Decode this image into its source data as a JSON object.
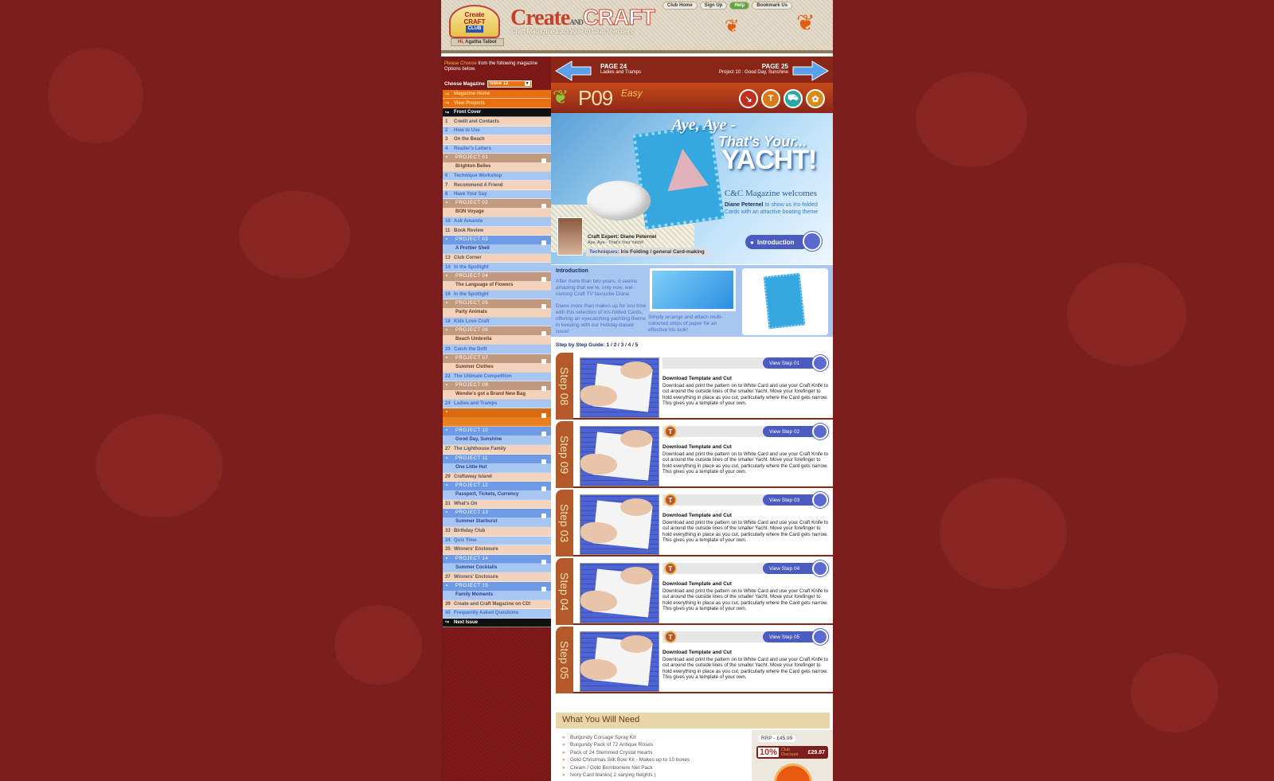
{
  "header": {
    "logo": {
      "line1": "Create",
      "line2": "CRAFT",
      "line3": "CLUB"
    },
    "greeting_hi": "Hi,",
    "greeting_name": "Agatha Talbot",
    "brand_create": "Create",
    "brand_and": "AND",
    "brand_craft": "CRAFT",
    "tagline": "Craft Magazine Exclusive to Club Members",
    "nav": [
      "Club Home",
      "Sign Up",
      "Help",
      "Bookmark Us"
    ]
  },
  "sidebar": {
    "intro_highlight": "Please Choose",
    "intro_rest": "from the following magazine Options below.",
    "choose_label": "Choose Magazine",
    "choose_value": "Issue 12",
    "top_items": [
      {
        "label": "Magazine Home"
      },
      {
        "label": "View Projects"
      },
      {
        "label": "Front Cover"
      }
    ],
    "items": [
      {
        "kind": "item",
        "num": "1",
        "label": "Credit and Contacts",
        "color": "peach"
      },
      {
        "kind": "item",
        "num": "2",
        "label": "How to Use",
        "color": "blue"
      },
      {
        "kind": "item",
        "num": "3",
        "label": "On the Beach",
        "color": "peach"
      },
      {
        "kind": "item",
        "num": "4",
        "label": "Reader's Letters",
        "color": "blue"
      },
      {
        "kind": "project",
        "proj": "PROJECT  01",
        "label": "Brighton Belles",
        "color": "brown"
      },
      {
        "kind": "item",
        "num": "6",
        "label": "Technique Workshop",
        "color": "blue"
      },
      {
        "kind": "item",
        "num": "7",
        "label": "Recommend A Friend",
        "color": "peach"
      },
      {
        "kind": "item",
        "num": "8",
        "label": "Have Your Say",
        "color": "blue"
      },
      {
        "kind": "project",
        "proj": "PROJECT  02",
        "label": "BON Voyage",
        "color": "brown"
      },
      {
        "kind": "item",
        "num": "10",
        "label": "Ask Amanda",
        "color": "blue"
      },
      {
        "kind": "item",
        "num": "11",
        "label": "Book Review",
        "color": "peach"
      },
      {
        "kind": "project",
        "proj": "PROJECT  03",
        "label": "A Prettier Shell",
        "color": "blue"
      },
      {
        "kind": "item",
        "num": "13",
        "label": "Club Corner",
        "color": "peach"
      },
      {
        "kind": "item",
        "num": "14",
        "label": "In the Spotlight",
        "color": "blue"
      },
      {
        "kind": "project",
        "proj": "PROJECT  04",
        "label": "The Language of Flowers",
        "color": "brown"
      },
      {
        "kind": "item",
        "num": "16",
        "label": "In the Spotlight",
        "color": "blue"
      },
      {
        "kind": "project",
        "proj": "PROJECT  05",
        "label": "Party Animals",
        "color": "brown"
      },
      {
        "kind": "item",
        "num": "18",
        "label": "Kids Love Craft",
        "color": "blue"
      },
      {
        "kind": "project",
        "proj": "PROJECT  06",
        "label": "Beach Umbrella",
        "color": "brown"
      },
      {
        "kind": "item",
        "num": "20",
        "label": "Catch the Drift",
        "color": "blue"
      },
      {
        "kind": "project",
        "proj": "PROJECT  07",
        "label": "Summer Clothes",
        "color": "brown"
      },
      {
        "kind": "item",
        "num": "22",
        "label": "The Ultimate Competition",
        "color": "blue"
      },
      {
        "kind": "project",
        "proj": "PROJECT  08",
        "label": "Wendie's got a Brand New Bag",
        "color": "brown"
      },
      {
        "kind": "item",
        "num": "24",
        "label": "Ladies and Tramps",
        "color": "blue"
      },
      {
        "kind": "project",
        "proj": "",
        "label": "",
        "color": "orange"
      },
      {
        "kind": "project",
        "proj": "PROJECT  10",
        "label": "Good Day, Sunshine",
        "color": "blue"
      },
      {
        "kind": "item",
        "num": "27",
        "label": "The Lighthouse Family",
        "color": "peach"
      },
      {
        "kind": "project",
        "proj": "PROJECT  11",
        "label": "One Little Hut",
        "color": "blue"
      },
      {
        "kind": "item",
        "num": "29",
        "label": "Craftaway Island",
        "color": "peach"
      },
      {
        "kind": "project",
        "proj": "PROJECT  12",
        "label": "Passport, Tickets, Currency",
        "color": "blue"
      },
      {
        "kind": "item",
        "num": "31",
        "label": "What's On",
        "color": "peach"
      },
      {
        "kind": "project",
        "proj": "PROJECT  13",
        "label": "Summer Starburst",
        "color": "blue"
      },
      {
        "kind": "item",
        "num": "33",
        "label": "Birthday Club",
        "color": "peach"
      },
      {
        "kind": "item",
        "num": "34",
        "label": "Quiz Time",
        "color": "blue"
      },
      {
        "kind": "item",
        "num": "35",
        "label": "Winners' Enclosure",
        "color": "peach"
      },
      {
        "kind": "project",
        "proj": "PROJECT  14",
        "label": "Summer Cocktails",
        "color": "blue"
      },
      {
        "kind": "item",
        "num": "37",
        "label": "Winners' Enclosure",
        "color": "peach"
      },
      {
        "kind": "project",
        "proj": "PROJECT  15",
        "label": "Family Moments",
        "color": "blue"
      },
      {
        "kind": "item",
        "num": "39",
        "label": "Create and Craft Magazine on CD!",
        "color": "peach"
      },
      {
        "kind": "item",
        "num": "40",
        "label": "Frequently Asked Questions",
        "color": "blue"
      }
    ],
    "next_issue": "Next Issue"
  },
  "pagenav": {
    "prev_page": "PAGE 24",
    "prev_title": "Ladies and Tramps",
    "next_page": "PAGE 25",
    "next_title": "Project 10 : Good Day, Sunshine"
  },
  "project": {
    "code": "P09",
    "level": "Easy",
    "hero_line1": "Aye, Aye -",
    "hero_line2": "That's Your...",
    "hero_line3": "YACHT!",
    "welcome": "C&C Magazine welcomes",
    "welcome_name": "Diane Peternel",
    "welcome_rest": " to show us Iris-folded Cards with an attactive boating theme",
    "expert": "Craft Expert: Diane Peternel",
    "expert_sub": "Aye, Aye - That's Your Yacht!",
    "techniques_label": "Techniques",
    "techniques_value": ": Iris Folding / general Card-making",
    "intro_button": "Introduction"
  },
  "intro": {
    "heading": "Introduction",
    "p1": "After more than two years, it seems amazing that we're, only now, wel-coming Craft TV favourite Diane",
    "p2": "Diane more than makes up for lost time with this selection of Iris-folded Cards, offering an eyecatching yachting theme in keeping with our Holiday-based issue!",
    "p3": "Simply arrange and attach multi-coloured strips of paper for an effective Iris look!"
  },
  "stepguide": {
    "label": "Step by Step Guide:",
    "links": "1 / 2 / 3 / 4 / 5"
  },
  "steps": [
    {
      "tab": "Step 08",
      "button": "View Step 01",
      "title": "Download Template and Cut",
      "text": "Download and print the pattern on to White Card and use your Craft Knife to cut around the outside lines of the smaller Yacht. Move your forefinger to hold everything in place as you cut, particularly where the Card gets narrow. This gives you a template of your own."
    },
    {
      "tab": "Step 09",
      "button": "View Step 02",
      "title": "Download Template and Cut",
      "text": "Download and print the pattern on to White Card and use your Craft Knife to cut around the outside lines of the smaller Yacht. Move your forefinger to hold everything in place as you cut, particularly where the Card gets narrow. This gives you a template of your own."
    },
    {
      "tab": "Step 03",
      "button": "View Step 03",
      "title": "Download Template and Cut",
      "text": "Download and print the pattern on to White Card and use your Craft Knife to cut around the outside lines of the smaller Yacht. Move your forefinger to hold everything in place as you cut, particularly where the Card gets narrow. This gives you a template of your own."
    },
    {
      "tab": "Step 04",
      "button": "View Step 04",
      "title": "Download Template and Cut",
      "text": "Download and print the pattern on to White Card and use your Craft Knife to cut around the outside lines of the smaller Yacht. Move your forefinger to hold everything in place as you cut, particularly where the Card gets narrow. This gives you a template of your own."
    },
    {
      "tab": "Step 05",
      "button": "View Step 05",
      "title": "Download Template and Cut",
      "text": "Download and print the pattern on to White Card and use your Craft Knife to cut around the outside lines of the smaller Yacht. Move your forefinger to hold everything in place as you cut, particularly where the Card gets narrow. This gives you a template of your own."
    }
  ],
  "needs": {
    "heading": "What You Will Need",
    "items": [
      "Burgundy Corsage Spray Kit",
      "Burgundy Pack of 72 Antique Roses",
      "Pack of 24 Stemmed Crystal Hearts",
      "Gold Christmas Silk Bow Kit - Makes up to 10 boxes",
      "Cream / Gold Bomboniere Net Pack",
      "Ivory Card blanks( 2 varying heights )"
    ],
    "rrp": "RRP - £45.99",
    "discount_pct": "10%",
    "discount_label1": "Club",
    "discount_label2": "Discount",
    "discount_price": "£29.87"
  },
  "icons": [
    "arrow-icon",
    "tips-icon",
    "cart-icon",
    "butterfly-icon"
  ]
}
